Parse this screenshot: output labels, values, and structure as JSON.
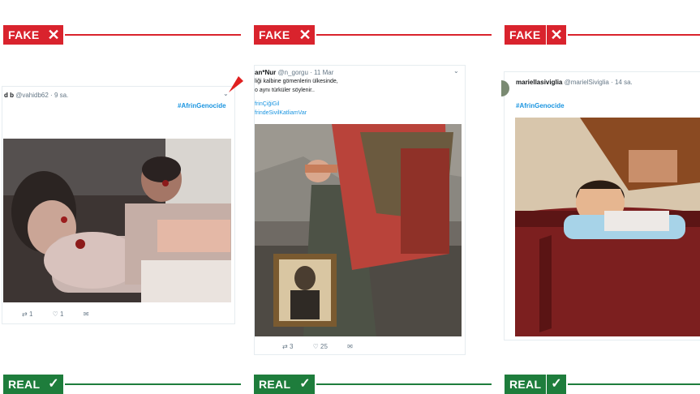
{
  "labels": {
    "fake": "FAKE",
    "real": "REAL",
    "x": "✕",
    "check": "✓"
  },
  "tweets": [
    {
      "handle_name": "d b",
      "handle_meta": "@vahidb62 · 9 sa.",
      "hashtag": "#AfrinGenocide",
      "retweets": "1",
      "likes": "1"
    },
    {
      "handle_name": "an*Nur",
      "handle_meta": "@n_gorgu · 11 Mar",
      "line1": "liği kalbine gömenlerin ülkesinde,",
      "line2": "o aynı türküler söylenir..",
      "tag1": "frinÇiğiGil",
      "tag2": "frindeSivilKatliamVar",
      "retweets": "3",
      "likes": "25"
    },
    {
      "handle_name": "mariellasiviglia",
      "handle_meta": "@marielSiviglia · 14 sa.",
      "hashtag": "#AfrinGenocide"
    }
  ],
  "icons": {
    "retweet": "⇄",
    "like": "♡",
    "dm": "✉",
    "chevron": "⌄"
  }
}
